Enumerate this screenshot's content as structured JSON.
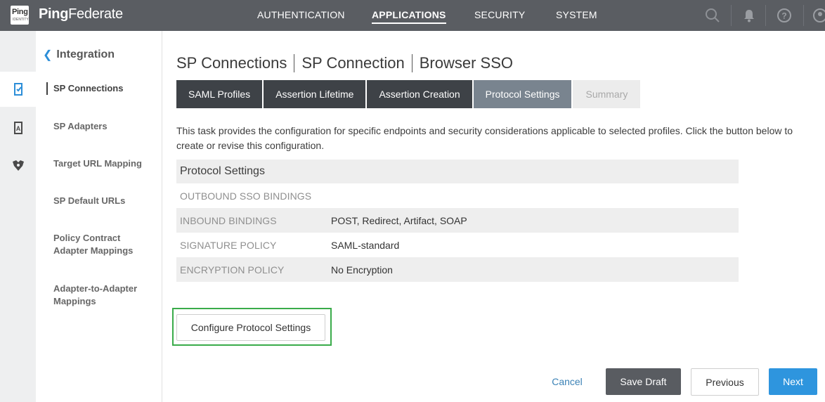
{
  "header": {
    "logo_top": "Ping",
    "logo_bottom": "IDENTITY",
    "brand_bold": "Ping",
    "brand_rest": "Federate",
    "nav": [
      {
        "label": "AUTHENTICATION"
      },
      {
        "label": "APPLICATIONS"
      },
      {
        "label": "SECURITY"
      },
      {
        "label": "SYSTEM"
      }
    ],
    "active_nav": "APPLICATIONS",
    "icons": [
      "search-icon",
      "bell-icon",
      "help-icon",
      "user-icon"
    ]
  },
  "rail": {
    "icons": [
      "sp-connections-icon",
      "sp-adapters-icon",
      "target-mapping-icon"
    ]
  },
  "sidebar": {
    "heading": "Integration",
    "items": [
      {
        "label": "SP Connections"
      },
      {
        "label": "SP Adapters"
      },
      {
        "label": "Target URL Mapping"
      },
      {
        "label": "SP Default URLs"
      },
      {
        "label": "Policy Contract Adapter Mappings"
      },
      {
        "label": "Adapter-to-Adapter Mappings"
      }
    ]
  },
  "main": {
    "breadcrumb": [
      "SP Connections",
      "SP Connection",
      "Browser SSO"
    ],
    "tabs": [
      {
        "label": "SAML Profiles"
      },
      {
        "label": "Assertion Lifetime"
      },
      {
        "label": "Assertion Creation"
      },
      {
        "label": "Protocol Settings"
      },
      {
        "label": "Summary"
      }
    ],
    "description": "This task provides the configuration for specific endpoints and security considerations applicable to selected profiles. Click the button below to create or revise this configuration.",
    "table": {
      "title": "Protocol Settings",
      "rows": [
        {
          "key": "OUTBOUND SSO BINDINGS",
          "value": ""
        },
        {
          "key": "INBOUND BINDINGS",
          "value": "POST, Redirect, Artifact, SOAP"
        },
        {
          "key": "SIGNATURE POLICY",
          "value": "SAML-standard"
        },
        {
          "key": "ENCRYPTION POLICY",
          "value": "No Encryption"
        }
      ]
    },
    "configure_label": "Configure Protocol Settings"
  },
  "footer": {
    "cancel": "Cancel",
    "save_draft": "Save Draft",
    "previous": "Previous",
    "next": "Next"
  },
  "colors": {
    "topbar": "#5a5d62",
    "tab_dark": "#3e4247",
    "tab_current": "#79848f",
    "accent_blue": "#2e95de",
    "highlight_green": "#3aab4a"
  }
}
